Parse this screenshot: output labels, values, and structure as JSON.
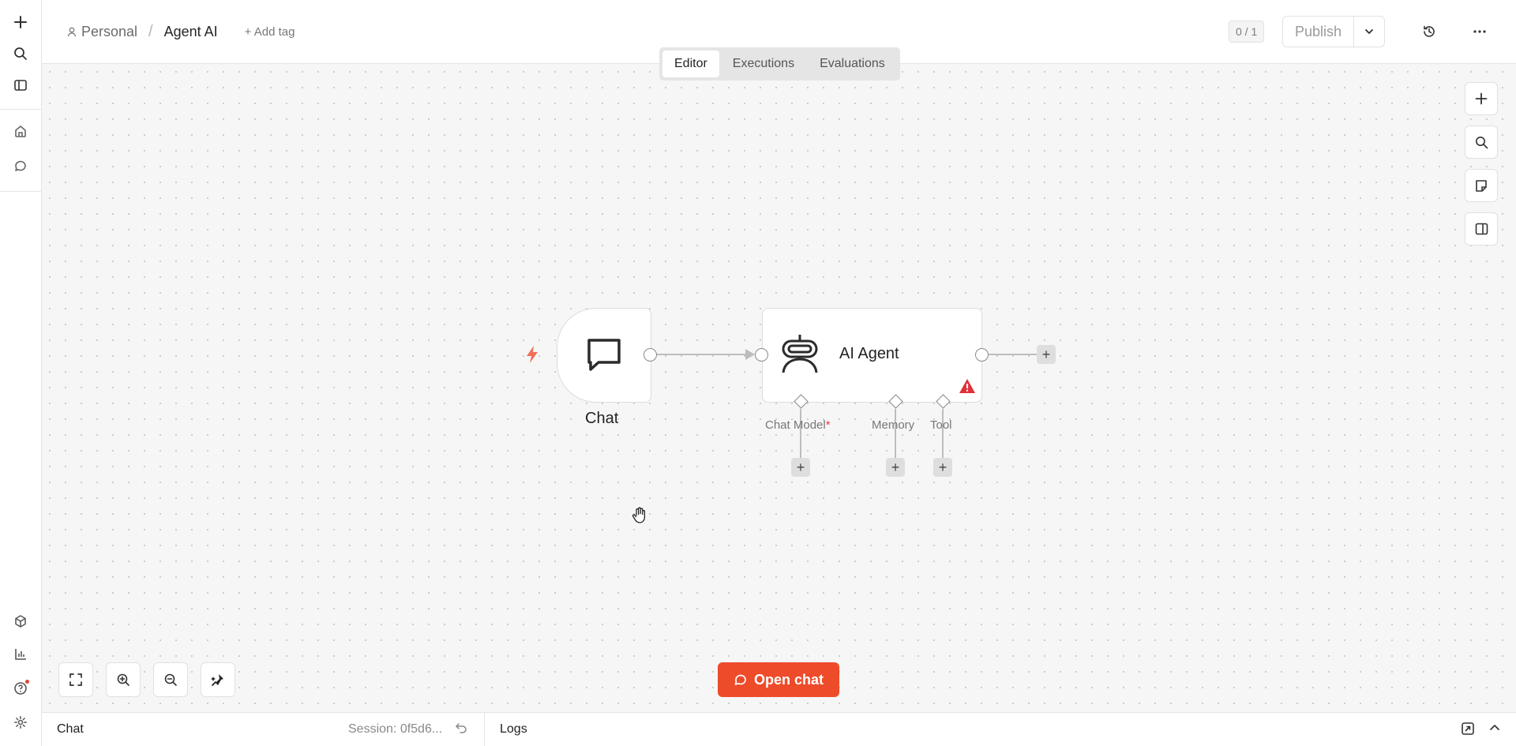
{
  "breadcrumb": {
    "project": "Personal",
    "separator": "/",
    "workflow": "Agent AI",
    "add_tag": "+ Add tag"
  },
  "header": {
    "counter": "0 / 1",
    "publish_label": "Publish"
  },
  "tabs": [
    {
      "label": "Editor",
      "active": true
    },
    {
      "label": "Executions",
      "active": false
    },
    {
      "label": "Evaluations",
      "active": false
    }
  ],
  "nodes": {
    "chat": {
      "label": "Chat"
    },
    "agent": {
      "label": "AI Agent",
      "inputs": {
        "chat_model": "Chat Model",
        "required_mark": "*",
        "memory": "Memory",
        "tool": "Tool"
      }
    }
  },
  "actions": {
    "open_chat": "Open chat"
  },
  "bottom_panel": {
    "chat_label": "Chat",
    "session": "Session: 0f5d6...",
    "logs_label": "Logs"
  },
  "colors": {
    "accent": "#ee4b2b",
    "trigger": "#f0705a",
    "warning": "#e0303a"
  },
  "icons": {
    "left_rail": [
      "plus-icon",
      "search-icon",
      "sidebar-icon",
      "home-icon",
      "chat-bubble-icon",
      "templates-icon",
      "insights-icon",
      "help-icon",
      "settings-icon"
    ],
    "canvas_right": [
      "plus-icon",
      "search-icon",
      "sticky-note-icon",
      "panel-icon"
    ],
    "canvas_bottom": [
      "fit-view-icon",
      "zoom-in-icon",
      "zoom-out-icon",
      "tidy-up-icon"
    ]
  }
}
